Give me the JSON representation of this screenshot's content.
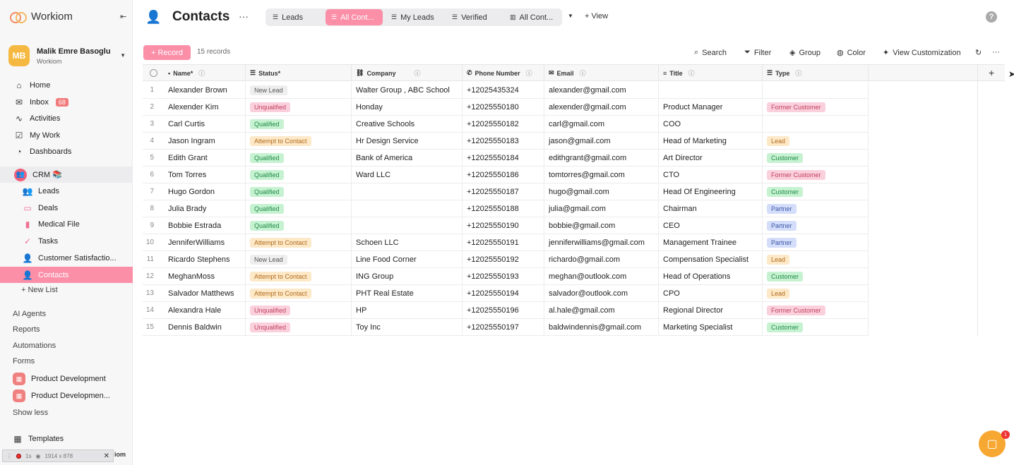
{
  "brand": {
    "name": "Workiom"
  },
  "user": {
    "initials": "MB",
    "name": "Malik Emre Basoglu",
    "org": "Workiom"
  },
  "nav": [
    {
      "label": "Home",
      "icon": "home-icon"
    },
    {
      "label": "Inbox",
      "icon": "inbox-icon",
      "badge": "68"
    },
    {
      "label": "Activities",
      "icon": "activity-icon"
    },
    {
      "label": "My Work",
      "icon": "checkbox-icon"
    },
    {
      "label": "Dashboards",
      "icon": "dashboard-icon"
    }
  ],
  "crm": {
    "label": "CRM 📚"
  },
  "crm_items": [
    {
      "label": "Leads",
      "icon": "users-icon"
    },
    {
      "label": "Deals",
      "icon": "money-icon"
    },
    {
      "label": "Medical File",
      "icon": "file-icon"
    },
    {
      "label": "Tasks",
      "icon": "check-icon"
    },
    {
      "label": "Customer Satisfactio...",
      "icon": "user-icon"
    },
    {
      "label": "Contacts",
      "icon": "contacts-icon"
    }
  ],
  "new_list": "+ New List",
  "sections": {
    "ai_agents": "AI Agents",
    "reports": "Reports",
    "automations": "Automations",
    "forms": "Forms",
    "show_less": "Show less",
    "templates": "Templates"
  },
  "forms": [
    {
      "label": "Product Development"
    },
    {
      "label": "Product Developmen..."
    }
  ],
  "devbar": {
    "time": "1s",
    "size": "1914 x 878",
    "tail": "iom"
  },
  "page": {
    "title": "Contacts",
    "more": "···"
  },
  "tabs": [
    {
      "label": "Leads"
    },
    {
      "label": "All Cont..."
    },
    {
      "label": "My Leads"
    },
    {
      "label": "Verified"
    },
    {
      "label": "All Cont..."
    }
  ],
  "add_view": "+ View",
  "toolbar": {
    "record": "+ Record",
    "count": "15 records",
    "search": "Search",
    "filter": "Filter",
    "group": "Group",
    "color": "Color",
    "view_custom": "View Customization"
  },
  "columns": [
    {
      "label": "Name*"
    },
    {
      "label": "Status*"
    },
    {
      "label": "Company"
    },
    {
      "label": "Phone Number"
    },
    {
      "label": "Email"
    },
    {
      "label": "Title"
    },
    {
      "label": "Type"
    }
  ],
  "rows": [
    {
      "n": "1",
      "name": "Alexander Brown",
      "status": "New Lead",
      "company": "Walter Group ,  ABC School",
      "phone": "+12025435324",
      "email": "alexander@gmail.com",
      "title": "",
      "type": ""
    },
    {
      "n": "2",
      "name": "Alexender Kim",
      "status": "Unqualified",
      "company": "Honday",
      "phone": "+12025550180",
      "email": "alexender@gmail.com",
      "title": "Product Manager",
      "type": "Former Customer"
    },
    {
      "n": "3",
      "name": "Carl Curtis",
      "status": "Qualified",
      "company": "Creative Schools",
      "phone": "+12025550182",
      "email": "carl@gmail.com",
      "title": "COO",
      "type": ""
    },
    {
      "n": "4",
      "name": "Jason Ingram",
      "status": "Attempt to Contact",
      "company": "Hr Design Service",
      "phone": "+12025550183",
      "email": "jason@gmail.com",
      "title": "Head of Marketing",
      "type": "Lead"
    },
    {
      "n": "5",
      "name": "Edith Grant",
      "status": "Qualified",
      "company": "Bank of America",
      "phone": "+12025550184",
      "email": "edithgrant@gmail.com",
      "title": "Art Director",
      "type": "Customer"
    },
    {
      "n": "6",
      "name": "Tom Torres",
      "status": "Qualified",
      "company": "Ward LLC",
      "phone": "+12025550186",
      "email": "tomtorres@gmail.com",
      "title": "CTO",
      "type": "Former Customer"
    },
    {
      "n": "7",
      "name": "Hugo Gordon",
      "status": "Qualified",
      "company": "",
      "phone": "+12025550187",
      "email": "hugo@gmail.com",
      "title": "Head Of Engineering",
      "type": "Customer"
    },
    {
      "n": "8",
      "name": "Julia Brady",
      "status": "Qualified",
      "company": "",
      "phone": "+12025550188",
      "email": "julia@gmail.com",
      "title": "Chairman",
      "type": "Partner"
    },
    {
      "n": "9",
      "name": "Bobbie Estrada",
      "status": "Qualified",
      "company": "",
      "phone": "+12025550190",
      "email": "bobbie@gmail.com",
      "title": "CEO",
      "type": "Partner"
    },
    {
      "n": "10",
      "name": "JenniferWilliams",
      "status": "Attempt to Contact",
      "company": "Schoen LLC",
      "phone": "+12025550191",
      "email": "jenniferwilliams@gmail.com",
      "title": "Management Trainee",
      "type": "Partner"
    },
    {
      "n": "11",
      "name": "Ricardo Stephens",
      "status": "New Lead",
      "company": "Line Food Corner",
      "phone": "+12025550192",
      "email": "richardo@gmail.com",
      "title": "Compensation Specialist",
      "type": "Lead"
    },
    {
      "n": "12",
      "name": "MeghanMoss",
      "status": "Attempt to Contact",
      "company": "ING Group",
      "phone": "+12025550193",
      "email": "meghan@outlook.com",
      "title": "Head of Operations",
      "type": "Customer"
    },
    {
      "n": "13",
      "name": "Salvador Matthews",
      "status": "Attempt to Contact",
      "company": "PHT Real Estate",
      "phone": "+12025550194",
      "email": "salvador@outlook.com",
      "title": "CPO",
      "type": "Lead"
    },
    {
      "n": "14",
      "name": "Alexandra Hale",
      "status": "Unqualified",
      "company": "HP",
      "phone": "+12025550196",
      "email": "al.hale@gmail.com",
      "title": "Regional Director",
      "type": "Former Customer"
    },
    {
      "n": "15",
      "name": "Dennis Baldwin",
      "status": "Unqualified",
      "company": "Toy Inc",
      "phone": "+12025550197",
      "email": "baldwindennis@gmail.com",
      "title": "Marketing Specialist",
      "type": "Customer"
    }
  ],
  "chat_badge": "1",
  "colors": {
    "accent": "#fb8fa8",
    "crm": "#f05f7a",
    "avatar": "#f5b942"
  }
}
